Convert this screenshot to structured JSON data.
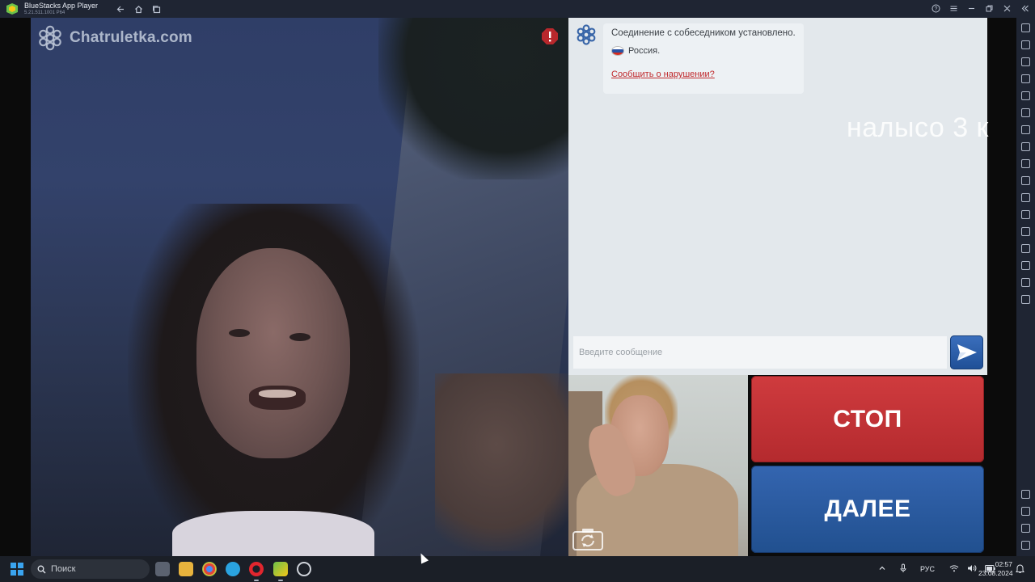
{
  "window": {
    "title": "BlueStacks App Player",
    "subtitle": "5.21.511.1001 P64"
  },
  "app": {
    "brand": "Chatruletka.com",
    "chat": {
      "connected_message": "Соединение с собеседником установлено.",
      "country": "Россия.",
      "report_link": "Сообщить о нарушении?"
    },
    "overlay_text": "налысо 3 к",
    "input": {
      "placeholder": "Введите сообщение",
      "value": ""
    },
    "buttons": {
      "stop": "СТОП",
      "next": "ДАЛЕЕ"
    },
    "colors": {
      "stop": "#c0323a",
      "next": "#2a5aa3",
      "send": "#2c5fab",
      "report": "#c0292c"
    }
  },
  "taskbar": {
    "search_label": "Поиск",
    "language": "РУС",
    "time": "02:57",
    "date": "23.08.2024",
    "apps": [
      "task-view",
      "file-explorer",
      "chrome",
      "telegram",
      "opera",
      "bluestacks",
      "recorder"
    ]
  }
}
